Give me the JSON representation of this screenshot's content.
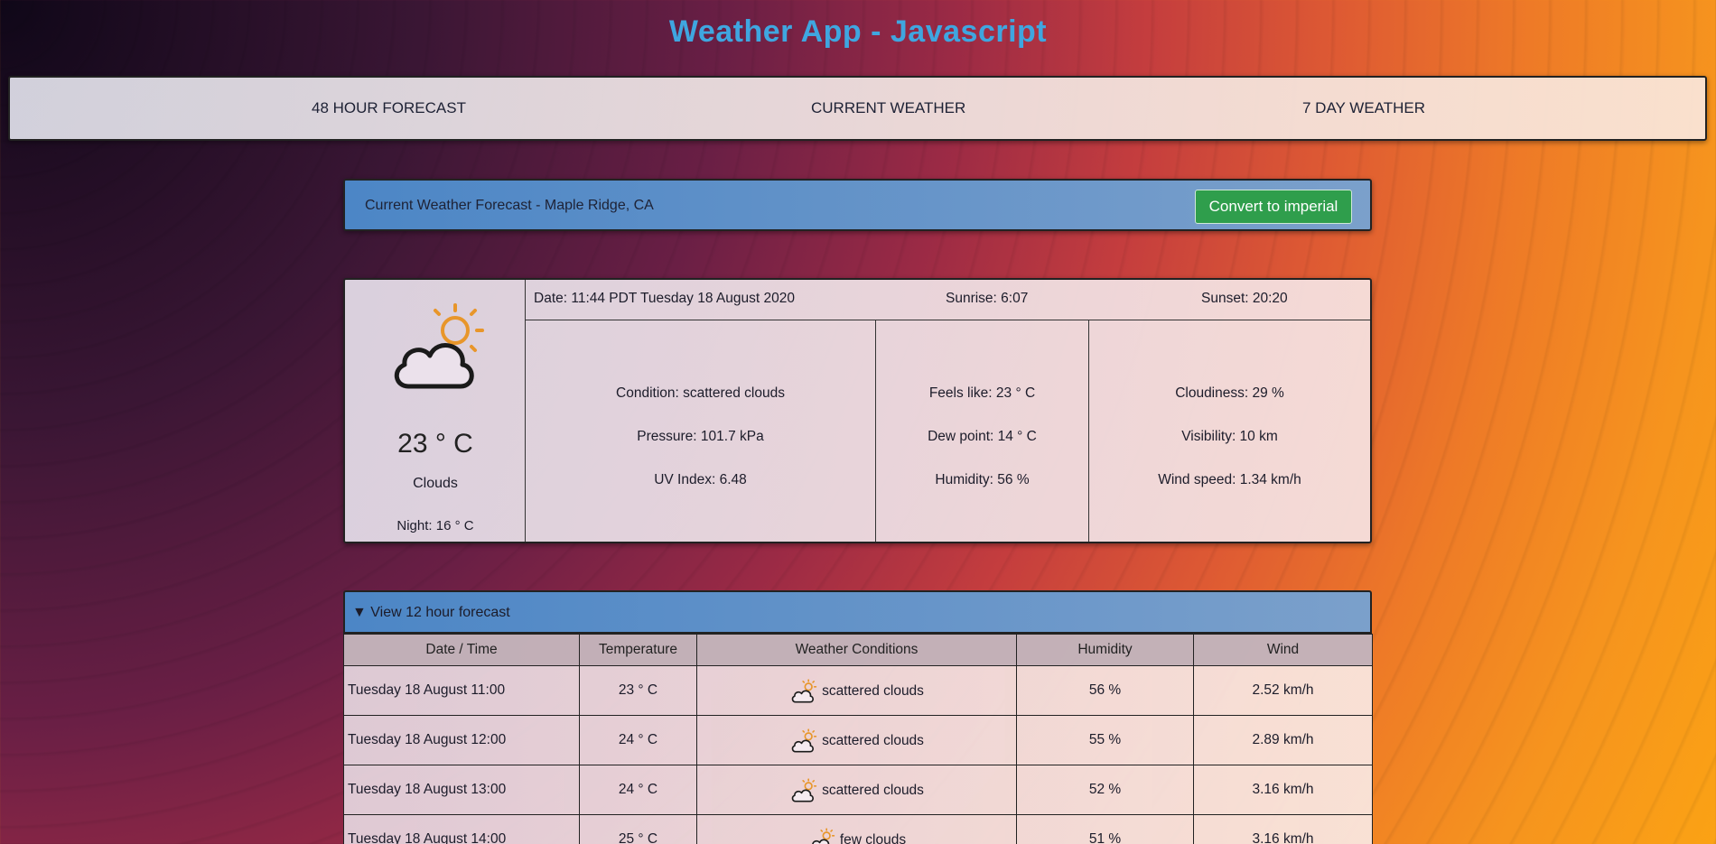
{
  "app": {
    "title": "Weather App - Javascript"
  },
  "nav": {
    "items": [
      {
        "label": "48 HOUR FORECAST"
      },
      {
        "label": "CURRENT WEATHER"
      },
      {
        "label": "7 DAY WEATHER"
      }
    ]
  },
  "current": {
    "header": "Current Weather Forecast - Maple Ridge, CA",
    "convert_label": "Convert to imperial",
    "icon": "partly-cloudy-icon",
    "temp": "23 ° C",
    "condition_main": "Clouds",
    "night": "Night: 16 ° C",
    "date": "Date: 11:44 PDT Tuesday 18 August 2020",
    "sunrise": "Sunrise: 6:07",
    "sunset": "Sunset: 20:20",
    "condition": "Condition: scattered clouds",
    "pressure": "Pressure: 101.7 kPa",
    "uv": "UV Index: 6.48",
    "feels_like": "Feels like: 23 ° C",
    "dew_point": "Dew point: 14 ° C",
    "humidity": "Humidity: 56 %",
    "cloudiness": "Cloudiness: 29 %",
    "visibility": "Visibility: 10 km",
    "wind_speed": "Wind speed: 1.34 km/h"
  },
  "hourly": {
    "toggle_label": "▼ View 12 hour forecast",
    "columns": [
      "Date / Time",
      "Temperature",
      "Weather Conditions",
      "Humidity",
      "Wind"
    ],
    "rows": [
      {
        "datetime": "Tuesday 18 August 11:00",
        "temp": "23 ° C",
        "conditions": "scattered clouds",
        "humidity": "56 %",
        "wind": "2.52 km/h"
      },
      {
        "datetime": "Tuesday 18 August 12:00",
        "temp": "24 ° C",
        "conditions": "scattered clouds",
        "humidity": "55 %",
        "wind": "2.89 km/h"
      },
      {
        "datetime": "Tuesday 18 August 13:00",
        "temp": "24 ° C",
        "conditions": "scattered clouds",
        "humidity": "52 %",
        "wind": "3.16 km/h"
      },
      {
        "datetime": "Tuesday 18 August 14:00",
        "temp": "25 ° C",
        "conditions": "few clouds",
        "humidity": "51 %",
        "wind": "3.16 km/h"
      }
    ]
  },
  "colors": {
    "title": "#3fa6e0",
    "header": "#4c86c6",
    "button": "#2f9e4c"
  }
}
